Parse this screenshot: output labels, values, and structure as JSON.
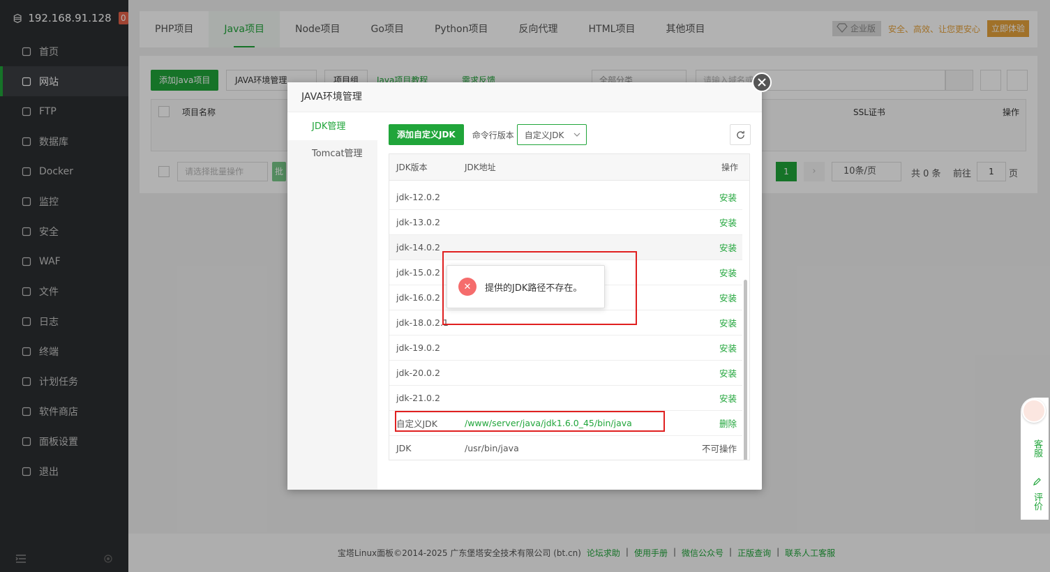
{
  "sidebar": {
    "ip": "192.168.91.128",
    "badge": "0",
    "items": [
      {
        "label": "首页",
        "icon": "home-icon"
      },
      {
        "label": "网站",
        "icon": "globe-icon"
      },
      {
        "label": "FTP",
        "icon": "ftp-icon"
      },
      {
        "label": "数据库",
        "icon": "database-icon"
      },
      {
        "label": "Docker",
        "icon": "docker-icon"
      },
      {
        "label": "监控",
        "icon": "monitor-icon"
      },
      {
        "label": "安全",
        "icon": "shield-icon"
      },
      {
        "label": "WAF",
        "icon": "waf-icon"
      },
      {
        "label": "文件",
        "icon": "folder-icon"
      },
      {
        "label": "日志",
        "icon": "log-icon"
      },
      {
        "label": "终端",
        "icon": "terminal-icon"
      },
      {
        "label": "计划任务",
        "icon": "calendar-icon"
      },
      {
        "label": "软件商店",
        "icon": "apps-icon"
      },
      {
        "label": "面板设置",
        "icon": "gear-icon"
      },
      {
        "label": "退出",
        "icon": "logout-icon"
      }
    ]
  },
  "topnav": {
    "tabs": [
      "PHP项目",
      "Java项目",
      "Node项目",
      "Go项目",
      "Python项目",
      "反向代理",
      "HTML项目",
      "其他项目"
    ],
    "enterprise": "企业版",
    "slogan": "安全、高效、让您更安心",
    "try_label": "立即体验"
  },
  "background": {
    "add_java": "添加Java项目",
    "env_mgmt": "JAVA环境管理",
    "project_group": "项目组",
    "tutorial": "Java项目教程",
    "feedback": "需求反馈",
    "category": "全部分类",
    "search_placeholder": "请输入域名或",
    "col_name": "项目名称",
    "col_ssl": "SSL证书",
    "col_action": "操作",
    "batch_placeholder": "请选择批量操作",
    "batch_btn": "批",
    "page_num": "1",
    "per_page": "10条/页",
    "total": "共 0 条",
    "goto": "前往",
    "goto_val": "1",
    "page_unit": "页"
  },
  "dialog": {
    "title": "JAVA环境管理",
    "left_tabs": [
      "JDK管理",
      "Tomcat管理"
    ],
    "add_jdk": "添加自定义JDK",
    "cmd_version_label": "命令行版本",
    "cmd_version_value": "自定义JDK",
    "columns": [
      "JDK版本",
      "JDK地址",
      "操作"
    ],
    "rows": [
      {
        "version": "jdk-12.0.2",
        "path": "",
        "action": "安装"
      },
      {
        "version": "jdk-13.0.2",
        "path": "",
        "action": "安装"
      },
      {
        "version": "jdk-14.0.2",
        "path": "",
        "action": "安装"
      },
      {
        "version": "jdk-15.0.2",
        "path": "",
        "action": "安装"
      },
      {
        "version": "jdk-16.0.2",
        "path": "",
        "action": "安装"
      },
      {
        "version": "jdk-18.0.2.1",
        "path": "",
        "action": "安装"
      },
      {
        "version": "jdk-19.0.2",
        "path": "",
        "action": "安装"
      },
      {
        "version": "jdk-20.0.2",
        "path": "",
        "action": "安装"
      },
      {
        "version": "jdk-21.0.2",
        "path": "",
        "action": "安装"
      },
      {
        "version": "自定义JDK",
        "path": "/www/server/java/jdk1.6.0_45/bin/java",
        "action": "删除"
      },
      {
        "version": "JDK",
        "path": "/usr/bin/java",
        "action": "不可操作"
      }
    ]
  },
  "toast": {
    "message": "提供的JDK路径不存在。"
  },
  "footer": {
    "copyright": "宝塔Linux面板©2014-2025 广东堡塔安全技术有限公司 (bt.cn)",
    "links": [
      "论坛求助",
      "使用手册",
      "微信公众号",
      "正版查询",
      "联系人工客服"
    ]
  },
  "service": {
    "chat": "客服",
    "rate": "评价"
  }
}
